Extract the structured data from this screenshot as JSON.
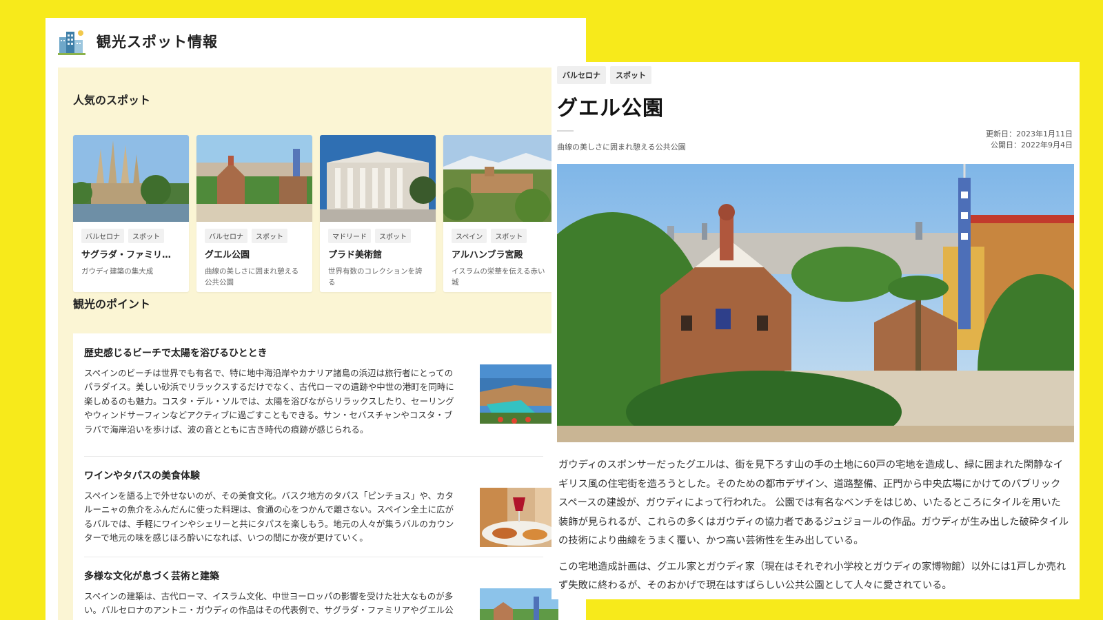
{
  "site": {
    "title": "観光スポット情報",
    "logo_icon": "city-buildings-icon"
  },
  "popular": {
    "heading": "人気のスポット",
    "cards": [
      {
        "tags": [
          "バルセロナ",
          "スポット"
        ],
        "title": "サグラダ・ファミリ…",
        "desc": "ガウディ建築の集大成",
        "image": "sagrada-familia-photo"
      },
      {
        "tags": [
          "バルセロナ",
          "スポット"
        ],
        "title": "グエル公園",
        "desc": "曲線の美しさに囲まれ憩える公共公園",
        "image": "park-guell-photo"
      },
      {
        "tags": [
          "マドリード",
          "スポット"
        ],
        "title": "プラド美術館",
        "desc": "世界有数のコレクションを誇る",
        "image": "prado-museum-photo"
      },
      {
        "tags": [
          "スペイン",
          "スポット"
        ],
        "title": "アルハンブラ宮殿",
        "desc": "イスラムの栄華を伝える赤い城",
        "image": "alhambra-photo"
      }
    ]
  },
  "points": {
    "heading": "観光のポイント",
    "items": [
      {
        "title": "歴史感じるビーチで太陽を浴びるひととき",
        "text": "スペインのビーチは世界でも有名で、特に地中海沿岸やカナリア諸島の浜辺は旅行者にとってのパラダイス。美しい砂浜でリラックスするだけでなく、古代ローマの遺跡や中世の港町を同時に楽しめるのも魅力。コスタ・デル・ソルでは、太陽を浴びながらリラックスしたり、セーリングやウィンドサーフィンなどアクティブに過ごすこともできる。サン・セバスチャンやコスタ・ブラバで海岸沿いを歩けば、波の音とともに古き時代の痕跡が感じられる。",
        "image": "beach-photo"
      },
      {
        "title": "ワインやタパスの美食体験",
        "text": "スペインを語る上で外せないのが、その美食文化。バスク地方のタパス「ピンチョス」や、カタルーニャの魚介をふんだんに使った料理は、食通の心をつかんで離さない。スペイン全土に広がるバルでは、手軽にワインやシェリーと共にタパスを楽しもう。地元の人々が集うバルのカウンターで地元の味を感じほろ酔いになれば、いつの間にか夜が更けていく。",
        "image": "tapas-wine-photo"
      },
      {
        "title": "多様な文化が息づく芸術と建築",
        "text": "スペインの建築は、古代ローマ、イスラム文化、中世ヨーロッパの影響を受けた壮大なものが多い。バルセロナのアントニ・ガウディの作品はその代表例で、サグラダ・ファミリアやグエル公園など、どこか夢幻的な世界が広がる。マドリードでは、プラド美術館でゴヤや",
        "image": "architecture-photo"
      }
    ]
  },
  "detail": {
    "tags": [
      "バルセロナ",
      "スポット"
    ],
    "title": "グエル公園",
    "subtitle": "曲線の美しさに囲まれ憩える公共公園",
    "updated": "更新日：2023年1月11日",
    "published": "公開日：2022年9月4日",
    "hero_image": "park-guell-panorama-photo",
    "paragraphs": [
      "ガウディのスポンサーだったグエルは、街を見下ろす山の手の土地に60戸の宅地を造成し、緑に囲まれた閑静なイギリス風の住宅街を造ろうとした。そのための都市デザイン、道路整備、正門から中央広場にかけてのパブリックスペースの建設が、ガウディによって行われた。 公園では有名なベンチをはじめ、いたるところにタイルを用いた装飾が見られるが、これらの多くはガウディの協力者であるジュジョールの作品。ガウディが生み出した破砕タイルの技術により曲線をうまく覆い、かつ高い芸術性を生み出している。",
      "この宅地造成計画は、グエル家とガウディ家（現在はそれぞれ小学校とガウディの家博物館）以外には1戸しか売れず失敗に終わるが、そのおかげで現在はすばらしい公共公園として人々に愛されている。"
    ]
  }
}
